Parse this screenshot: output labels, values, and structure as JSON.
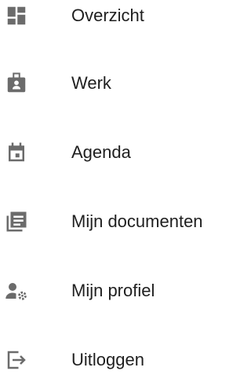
{
  "colors": {
    "icon": "#6b6b6b",
    "text": "#1f1f1f",
    "background": "#ffffff"
  },
  "menu": {
    "items": [
      {
        "label": "Overzicht",
        "icon": "dashboard-icon"
      },
      {
        "label": "Werk",
        "icon": "work-badge-icon"
      },
      {
        "label": "Agenda",
        "icon": "calendar-icon"
      },
      {
        "label": "Mijn documenten",
        "icon": "documents-icon"
      },
      {
        "label": "Mijn profiel",
        "icon": "profile-settings-icon"
      },
      {
        "label": "Uitloggen",
        "icon": "logout-icon"
      }
    ]
  }
}
